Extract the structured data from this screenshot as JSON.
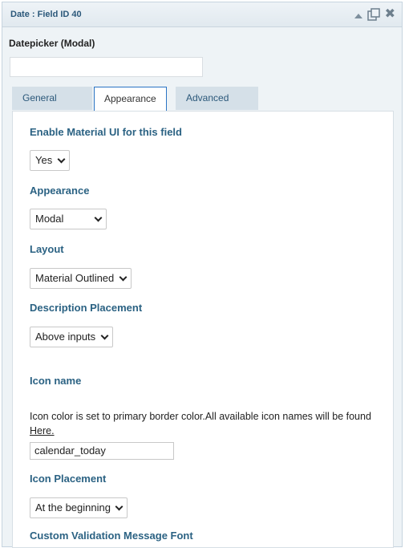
{
  "panel": {
    "title": "Date : Field ID 40",
    "icons": [
      "collapse-up-icon",
      "duplicate-icon",
      "close-icon"
    ]
  },
  "field": {
    "label": "Datepicker (Modal)",
    "label_value": ""
  },
  "tabs": [
    {
      "label": "General",
      "active": false
    },
    {
      "label": "Appearance",
      "active": true
    },
    {
      "label": "Advanced",
      "active": false
    }
  ],
  "appearance": {
    "material_ui": {
      "label": "Enable Material UI for this field",
      "value": "Yes"
    },
    "appearance": {
      "label": "Appearance",
      "value": "Modal"
    },
    "layout": {
      "label": "Layout",
      "value": "Material Outlined"
    },
    "description_placement": {
      "label": "Description Placement",
      "value": "Above inputs"
    },
    "icon_name": {
      "label": "Icon name",
      "help_text": "Icon color is set to primary border color.All available icon names will be found",
      "help_link": "Here.",
      "value": "calendar_today"
    },
    "icon_placement": {
      "label": "Icon Placement",
      "value": "At the beginning"
    },
    "partial_label": "Custom Validation Message Font"
  },
  "colors": {
    "accent_label": "#2b6283",
    "tab_border": "#2a74c4"
  }
}
